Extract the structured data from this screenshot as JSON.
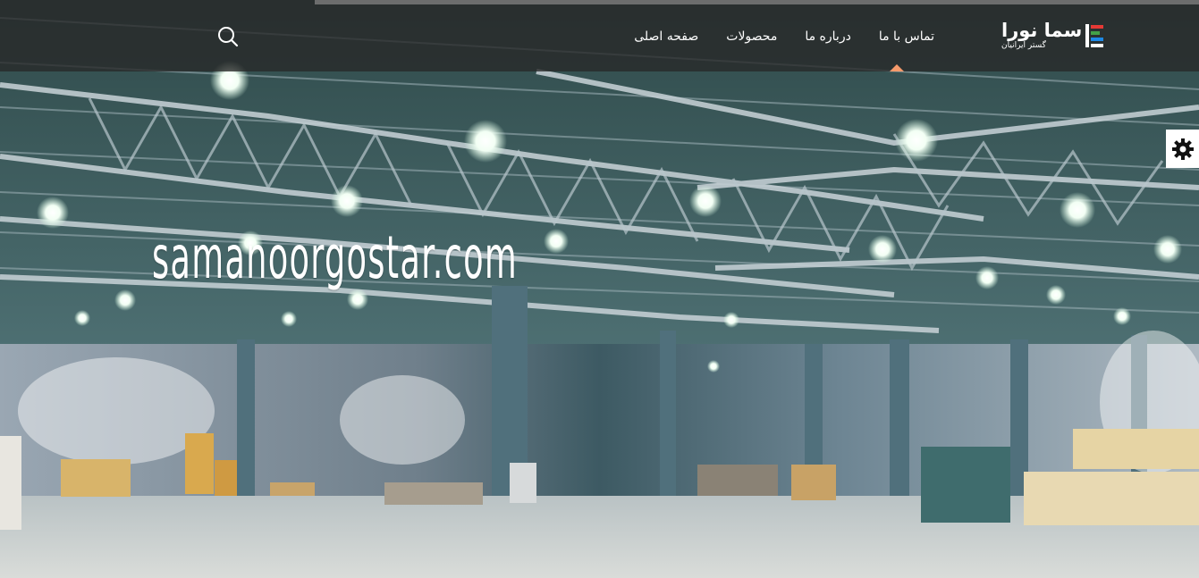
{
  "header": {
    "logo": {
      "main": "سما نورا",
      "sub": "گستر ایرانیان",
      "colors": [
        "#e53935",
        "#43a047",
        "#1e88e5"
      ]
    },
    "nav": [
      {
        "label": "صفحه اصلی",
        "active": true
      },
      {
        "label": "محصولات",
        "active": false
      },
      {
        "label": "درباره ما",
        "active": false
      },
      {
        "label": "تماس با ما",
        "active": false
      }
    ],
    "search_icon": "search-icon",
    "accent_color": "#f59a6b"
  },
  "settings": {
    "icon": "gear-icon"
  },
  "hero": {
    "title": "samanoorgostar.com"
  }
}
